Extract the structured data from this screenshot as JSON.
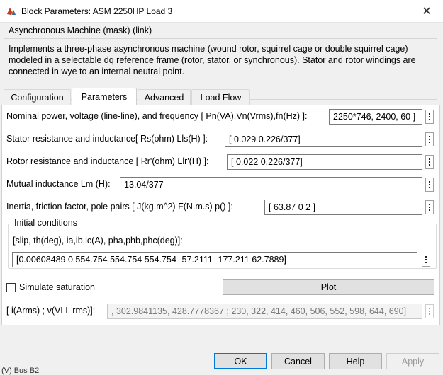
{
  "window": {
    "title": "Block Parameters: ASM 2250HP Load 3",
    "close_symbol": "✕"
  },
  "mask": {
    "header": "Asynchronous Machine (mask) (link)",
    "description": "Implements a three-phase asynchronous machine (wound rotor, squirrel cage or double squirrel cage) modeled in a selectable dq reference frame (rotor, stator, or synchronous). Stator and rotor windings are connected in wye to an internal neutral point."
  },
  "tabs": [
    {
      "label": "Configuration",
      "active": false
    },
    {
      "label": "Parameters",
      "active": true
    },
    {
      "label": "Advanced",
      "active": false
    },
    {
      "label": "Load Flow",
      "active": false
    }
  ],
  "params": [
    {
      "label": "Nominal power, voltage (line-line), and frequency [ Pn(VA),Vn(Vrms),fn(Hz) ]:",
      "value": "2250*746, 2400, 60 ]"
    },
    {
      "label": "Stator resistance and inductance[ Rs(ohm)  Lls(H) ]:",
      "value": "[ 0.029 0.226/377]"
    },
    {
      "label": "Rotor resistance and inductance [ Rr'(ohm)  Llr'(H) ]:",
      "value": "[ 0.022 0.226/377]"
    },
    {
      "label": "Mutual inductance Lm (H):",
      "value": "13.04/377"
    },
    {
      "label": "Inertia, friction factor, pole pairs [ J(kg.m^2)  F(N.m.s)   p() ]:",
      "value": "[ 63.87 0  2 ]"
    }
  ],
  "initial_conditions": {
    "legend": "Initial conditions",
    "sublabel": "[slip, th(deg), ia,ib,ic(A), pha,phb,phc(deg)]:",
    "value": "[0.00608489 0 554.754 554.754 554.754 -57.2111 -177.211 62.7889]"
  },
  "saturation": {
    "checkbox_label": "Simulate saturation",
    "checked": false,
    "plot_label": "Plot",
    "curve_label": "[ i(Arms) ; v(VLL rms)]:",
    "curve_value": ", 302.9841135, 428.7778367 ; 230, 322, 414, 460, 506, 552, 598, 644, 690]"
  },
  "buttons": {
    "ok": "OK",
    "cancel": "Cancel",
    "help": "Help",
    "apply": "Apply"
  },
  "background_text": "(V) Bus B2",
  "colors": {
    "accent": "#0078d7",
    "window_bg": "#f0f0f0",
    "panel_bg": "#ffffff"
  }
}
